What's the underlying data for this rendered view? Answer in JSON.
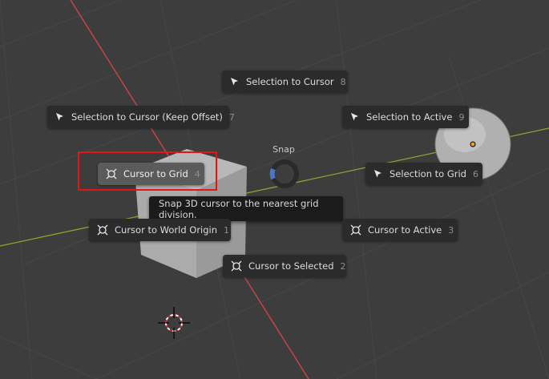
{
  "pie_menu": {
    "title": "Snap",
    "items": [
      {
        "label": "Selection to Cursor",
        "key": "8",
        "icon": "cursor-arrow-icon"
      },
      {
        "label": "Selection to Cursor (Keep Offset)",
        "key": "7",
        "icon": "cursor-arrow-icon"
      },
      {
        "label": "Selection to Active",
        "key": "9",
        "icon": "cursor-arrow-icon"
      },
      {
        "label": "Cursor to Grid",
        "key": "4",
        "icon": "3d-cursor-icon"
      },
      {
        "label": "Selection to Grid",
        "key": "6",
        "icon": "cursor-arrow-icon"
      },
      {
        "label": "Cursor to World Origin",
        "key": "1",
        "icon": "3d-cursor-icon"
      },
      {
        "label": "Cursor to Active",
        "key": "3",
        "icon": "3d-cursor-icon"
      },
      {
        "label": "Cursor to Selected",
        "key": "2",
        "icon": "3d-cursor-icon"
      }
    ]
  },
  "tooltip": {
    "text": "Snap 3D cursor to the nearest grid division."
  },
  "colors": {
    "background": "#3d3d3d",
    "menu_item": "#2b2b2b",
    "menu_item_active": "#5b5b5b",
    "highlight": "#e81414",
    "x_axis": "#c54545",
    "y_axis": "#8ba62f",
    "pie_indicator": "#4a77c4"
  }
}
